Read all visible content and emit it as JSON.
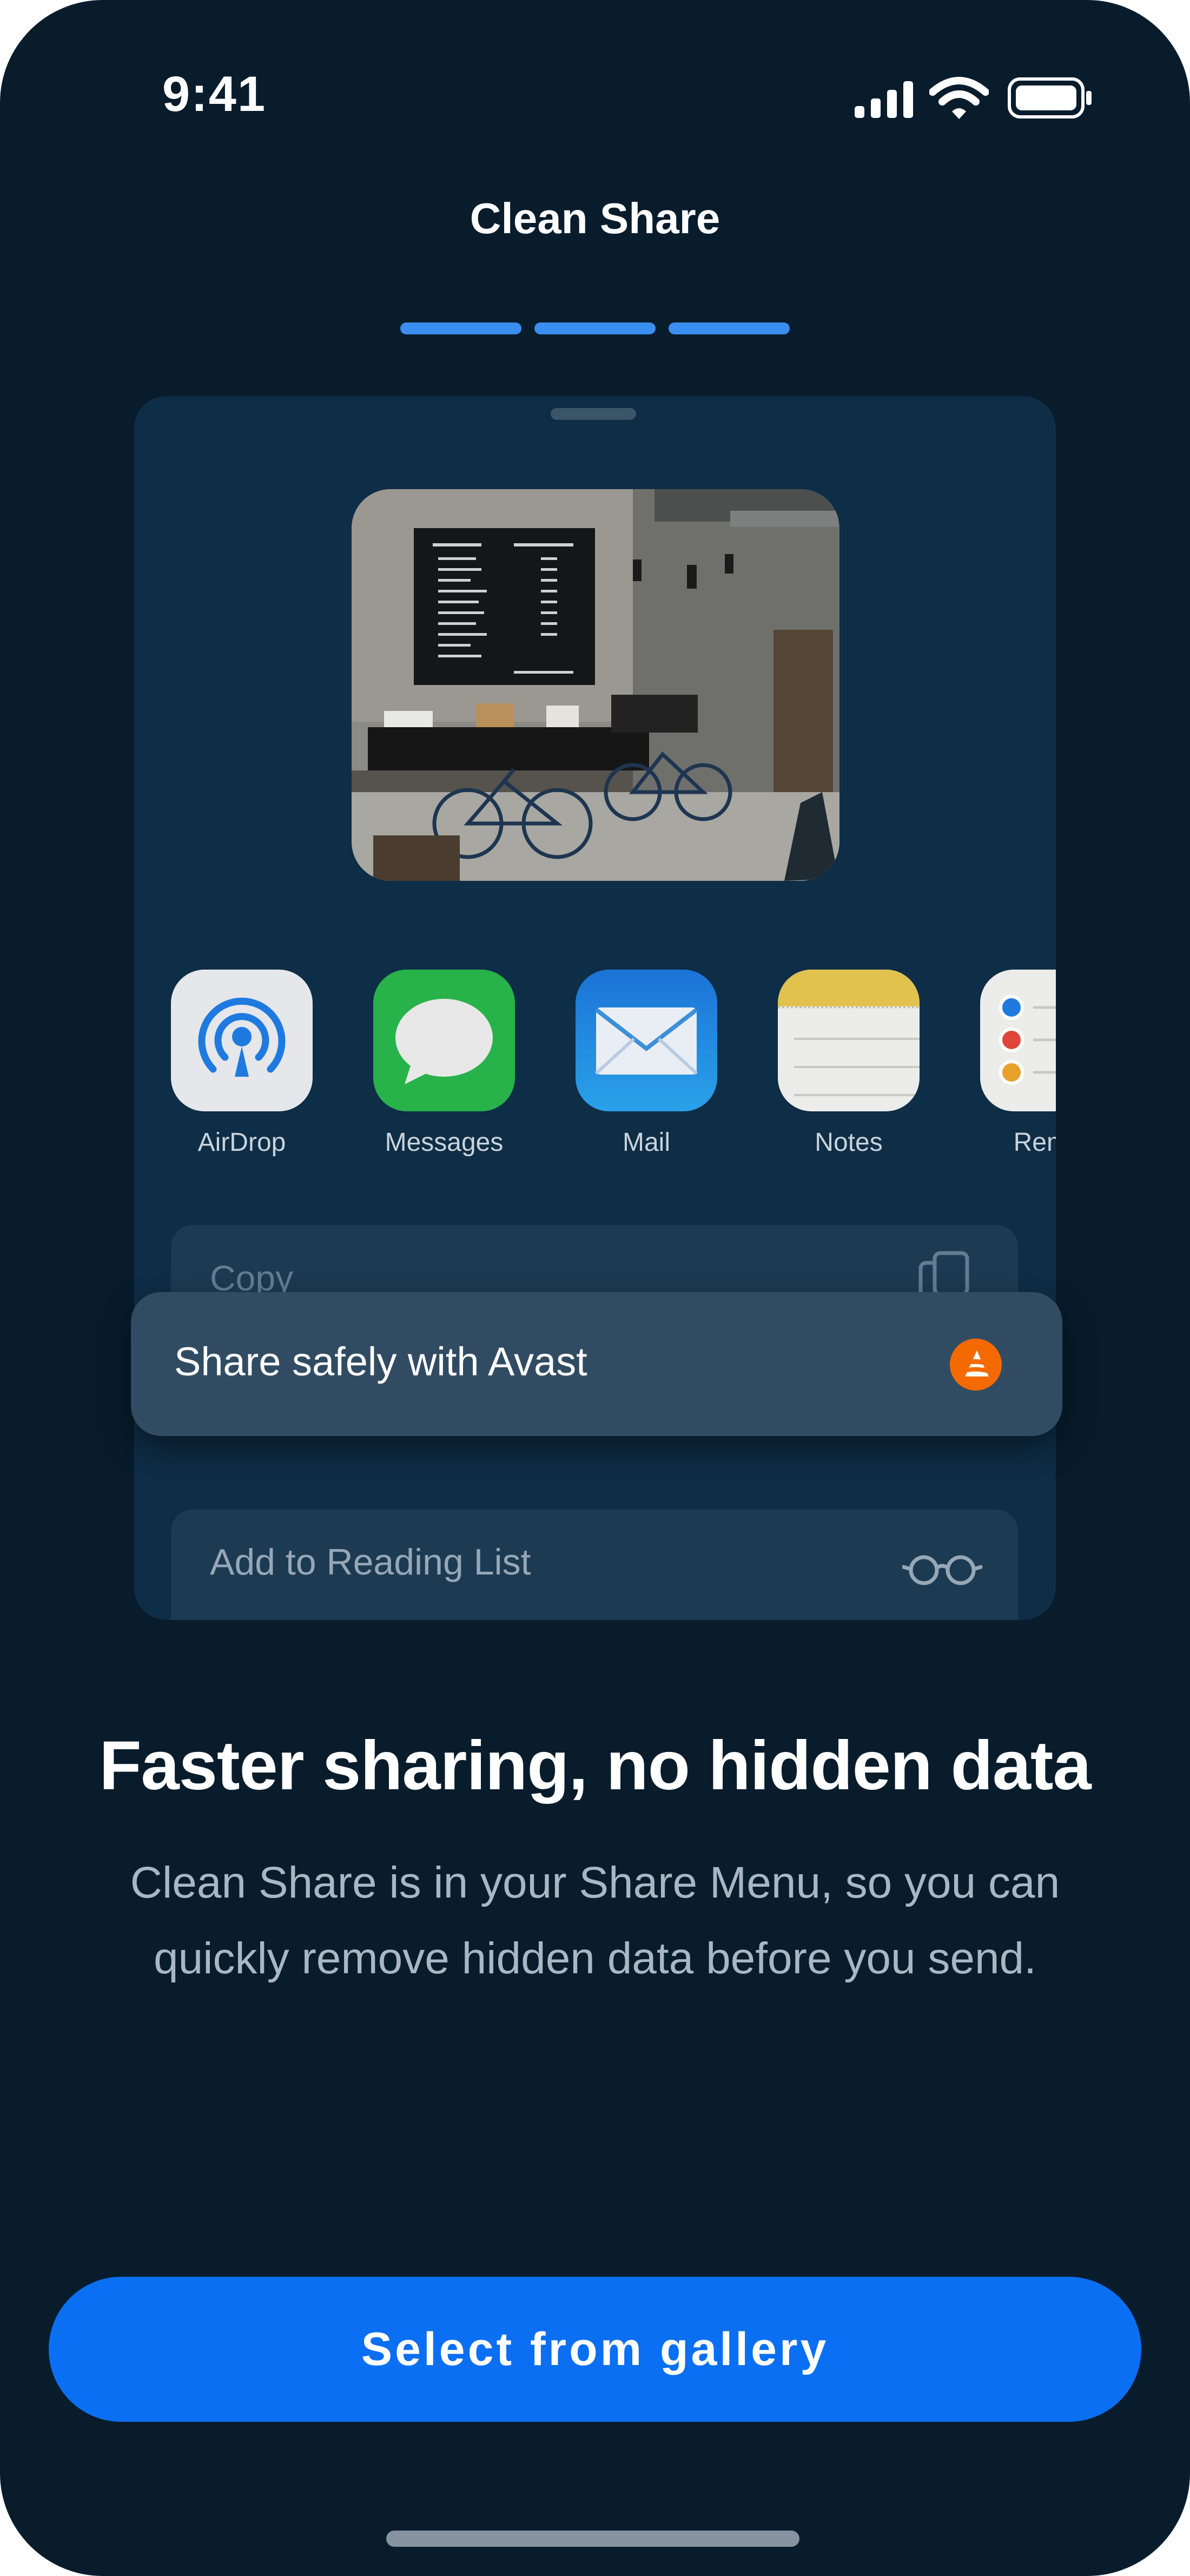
{
  "status_bar": {
    "time": "9:41"
  },
  "header": {
    "title": "Clean Share",
    "progress_steps": 3,
    "progress_active": 3
  },
  "share_sheet": {
    "apps": [
      {
        "label": "AirDrop",
        "icon": "airdrop-icon"
      },
      {
        "label": "Messages",
        "icon": "messages-icon"
      },
      {
        "label": "Mail",
        "icon": "mail-icon"
      },
      {
        "label": "Notes",
        "icon": "notes-icon"
      },
      {
        "label": "Remin",
        "icon": "reminders-icon"
      }
    ],
    "copy_label": "Copy",
    "avast_label": "Share safely with Avast",
    "reading_list_label": "Add to Reading List"
  },
  "content": {
    "headline": "Faster sharing, no hidden data",
    "description_line1": "Clean Share is in your Share Menu, so you can",
    "description_line2": "quickly remove hidden data before you send."
  },
  "cta": {
    "label": "Select from gallery"
  },
  "colors": {
    "background": "#081c2c",
    "accent": "#0a6ff2",
    "progress": "#3a8ef0",
    "avast_orange": "#f56a00"
  }
}
